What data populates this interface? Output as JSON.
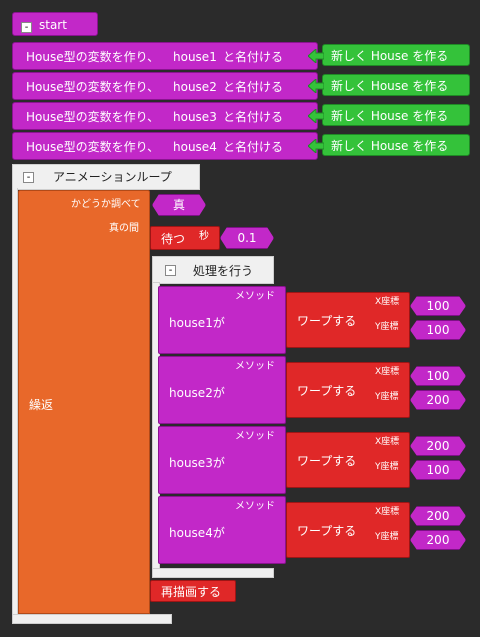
{
  "start": {
    "label": "start",
    "collapse": "-"
  },
  "variables": [
    {
      "prefix": "House型の変数を作り、",
      "name": "house1",
      "suffix": "と名付ける",
      "new_label": "新しく House を作る"
    },
    {
      "prefix": "House型の変数を作り、",
      "name": "house2",
      "suffix": "と名付ける",
      "new_label": "新しく House を作る"
    },
    {
      "prefix": "House型の変数を作り、",
      "name": "house3",
      "suffix": "と名付ける",
      "new_label": "新しく House を作る"
    },
    {
      "prefix": "House型の変数を作り、",
      "name": "house4",
      "suffix": "と名付ける",
      "new_label": "新しく House を作る"
    }
  ],
  "anim_loop": {
    "title": "アニメーションループ",
    "collapse": "-"
  },
  "loop": {
    "repeat_label": "繰返",
    "check_label": "かどうか調べて",
    "condition_value": "真",
    "while_label": "真の間"
  },
  "wait": {
    "label": "待つ",
    "unit": "秒",
    "value": "0.1"
  },
  "do_block": {
    "label": "処理を行う",
    "collapse": "-"
  },
  "method_calls": [
    {
      "method_label": "メソッド",
      "target": "house1が",
      "action": "ワープする",
      "x_label": "X座標",
      "x": "100",
      "y_label": "Y座標",
      "y": "100"
    },
    {
      "method_label": "メソッド",
      "target": "house2が",
      "action": "ワープする",
      "x_label": "X座標",
      "x": "100",
      "y_label": "Y座標",
      "y": "200"
    },
    {
      "method_label": "メソッド",
      "target": "house3が",
      "action": "ワープする",
      "x_label": "X座標",
      "x": "200",
      "y_label": "Y座標",
      "y": "100"
    },
    {
      "method_label": "メソッド",
      "target": "house4が",
      "action": "ワープする",
      "x_label": "X座標",
      "x": "200",
      "y_label": "Y座標",
      "y": "200"
    }
  ],
  "redraw": {
    "label": "再描画する"
  }
}
